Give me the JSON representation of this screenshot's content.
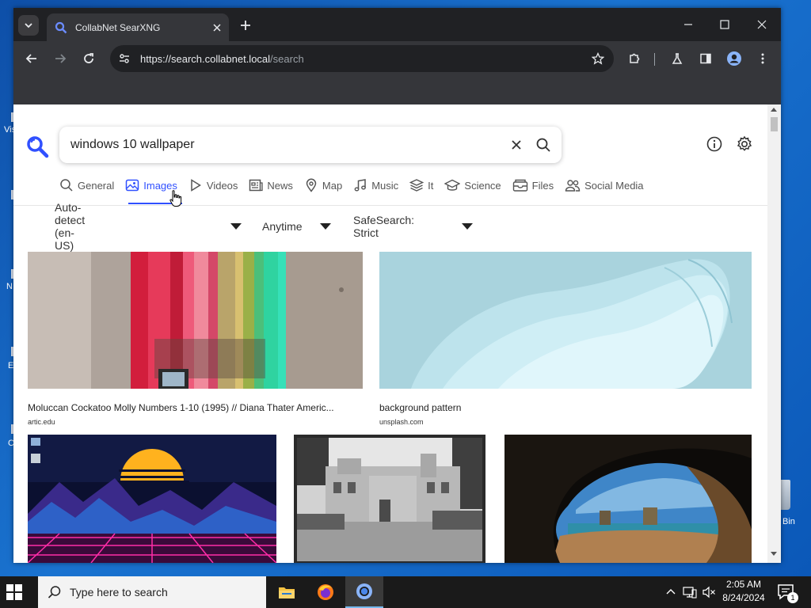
{
  "browser": {
    "tab_title": "CollabNet SearXNG",
    "url_host": "https://search.collabnet.local",
    "url_path": "/search"
  },
  "search": {
    "query": "windows 10 wallpaper",
    "categories": [
      {
        "label": "General",
        "icon": "search-icon",
        "active": false
      },
      {
        "label": "Images",
        "icon": "image-icon",
        "active": true
      },
      {
        "label": "Videos",
        "icon": "play-icon",
        "active": false
      },
      {
        "label": "News",
        "icon": "newspaper-icon",
        "active": false
      },
      {
        "label": "Map",
        "icon": "map-pin-icon",
        "active": false
      },
      {
        "label": "Music",
        "icon": "music-note-icon",
        "active": false
      },
      {
        "label": "It",
        "icon": "layers-icon",
        "active": false
      },
      {
        "label": "Science",
        "icon": "graduation-cap-icon",
        "active": false
      },
      {
        "label": "Files",
        "icon": "file-tray-icon",
        "active": false
      },
      {
        "label": "Social Media",
        "icon": "people-icon",
        "active": false
      }
    ],
    "filters": {
      "language": "Auto-detect (en-US)",
      "time": "Anytime",
      "safesearch": "SafeSearch: Strict"
    }
  },
  "results": [
    {
      "title": "Moluccan Cockatoo Molly Numbers 1-10 (1995) // Diana Thater Americ...",
      "source": "artic.edu"
    },
    {
      "title": "background pattern",
      "source": "unsplash.com"
    },
    {
      "title": "",
      "source": ""
    },
    {
      "title": "",
      "source": ""
    },
    {
      "title": "",
      "source": ""
    }
  ],
  "taskbar": {
    "search_placeholder": "Type here to search",
    "time": "2:05 AM",
    "date": "8/24/2024",
    "notification_count": "1"
  },
  "desktop": {
    "recycle_bin_fragment": "Bin",
    "left_fragments": [
      "Vis",
      "N",
      "E",
      "C"
    ]
  }
}
